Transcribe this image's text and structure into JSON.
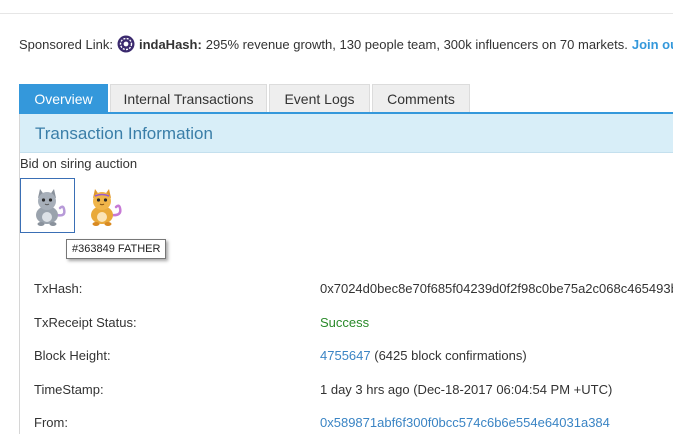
{
  "sponsored": {
    "label": "Sponsored Link:",
    "brand": "indaHash:",
    "text": "295% revenue growth, 130 people team, 300k influencers on 70 markets.",
    "link": "Join ou"
  },
  "tabs": [
    {
      "label": "Overview",
      "active": true
    },
    {
      "label": "Internal Transactions",
      "active": false
    },
    {
      "label": "Event Logs",
      "active": false
    },
    {
      "label": "Comments",
      "active": false
    }
  ],
  "panel": {
    "title": "Transaction Information",
    "note": "Bid on siring auction",
    "tooltip": "#363849 FATHER"
  },
  "kitties": [
    {
      "icon": "gray-cat-icon",
      "selected": true
    },
    {
      "icon": "orange-cat-icon",
      "selected": false
    }
  ],
  "fields": {
    "txhash": {
      "label": "TxHash:",
      "value": "0x7024d0bec8e70f685f04239d0f2f98c0be75a2c068c465493b"
    },
    "status": {
      "label": "TxReceipt Status:",
      "value": "Success"
    },
    "block": {
      "label": "Block Height:",
      "value": "4755647",
      "extra": "(6425 block confirmations)"
    },
    "timestamp": {
      "label": "TimeStamp:",
      "value": "1 day 3 hrs ago (Dec-18-2017 06:04:54 PM +UTC)"
    },
    "from": {
      "label": "From:",
      "value": "0x589871abf6f300f0bcc574c6b6e554e64031a384"
    }
  },
  "colors": {
    "accent": "#3498db",
    "panel_head": "#d8eef8",
    "success": "#2a8a2a",
    "link": "#3a84c4"
  }
}
